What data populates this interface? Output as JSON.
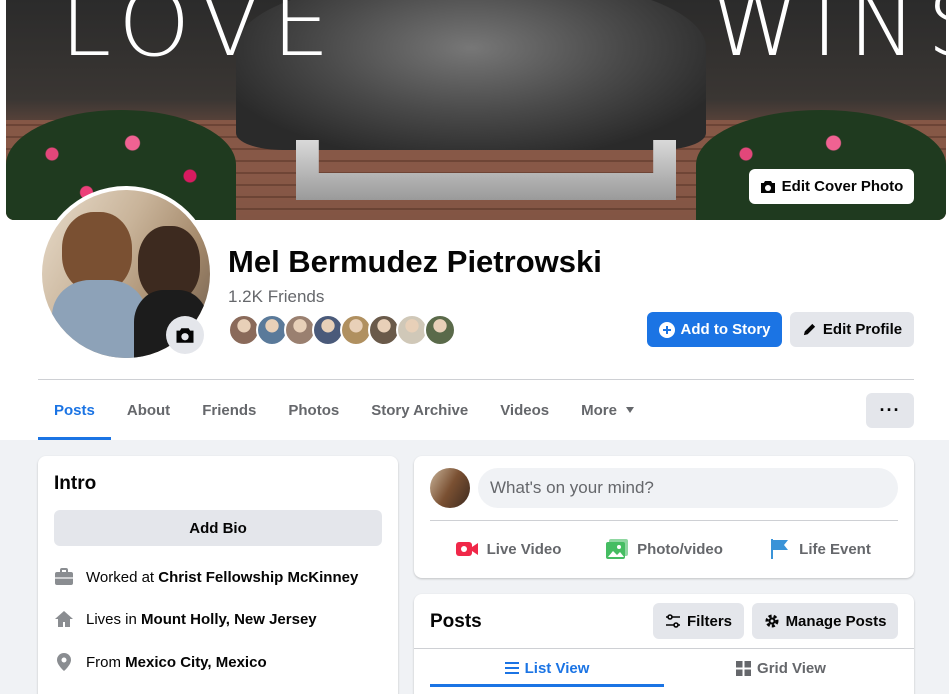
{
  "cover": {
    "words": [
      "LOVE",
      "WINS"
    ],
    "edit_cover_label": "Edit Cover Photo"
  },
  "profile": {
    "name": "Mel Bermudez Pietrowski",
    "friends_count": "1.2K Friends",
    "friend_avatar_colors": [
      "#8a6a5a",
      "#5a7a9a",
      "#9a8070",
      "#4a5a7a",
      "#b09060",
      "#6a5a4a",
      "#d0c8b8",
      "#5a6a4a"
    ]
  },
  "actions": {
    "add_to_story": "Add to Story",
    "edit_profile": "Edit Profile",
    "more_options": "···"
  },
  "tabs": [
    {
      "label": "Posts",
      "active": true
    },
    {
      "label": "About"
    },
    {
      "label": "Friends"
    },
    {
      "label": "Photos"
    },
    {
      "label": "Story Archive"
    },
    {
      "label": "Videos"
    },
    {
      "label": "More",
      "dropdown": true
    }
  ],
  "intro": {
    "title": "Intro",
    "add_bio": "Add Bio",
    "items": [
      {
        "icon": "briefcase-icon",
        "prefix": "Worked at ",
        "value": "Christ Fellowship McKinney"
      },
      {
        "icon": "home-icon",
        "prefix": "Lives in ",
        "value": "Mount Holly, New Jersey"
      },
      {
        "icon": "location-pin-icon",
        "prefix": "From ",
        "value": "Mexico City, Mexico"
      }
    ]
  },
  "composer": {
    "placeholder": "What's on your mind?",
    "actions": [
      {
        "label": "Live Video",
        "icon": "live-video-icon",
        "color": "#f02849"
      },
      {
        "label": "Photo/video",
        "icon": "photo-icon",
        "color": "#45bd62"
      },
      {
        "label": "Life Event",
        "icon": "flag-icon",
        "color": "#1b74e4"
      }
    ]
  },
  "posts": {
    "title": "Posts",
    "filters": "Filters",
    "manage_posts": "Manage Posts",
    "views": [
      {
        "label": "List View",
        "active": true
      },
      {
        "label": "Grid View"
      }
    ]
  },
  "colors": {
    "accent": "#1b74e4",
    "secondary_text": "#65676b",
    "background": "#f0f2f5"
  }
}
